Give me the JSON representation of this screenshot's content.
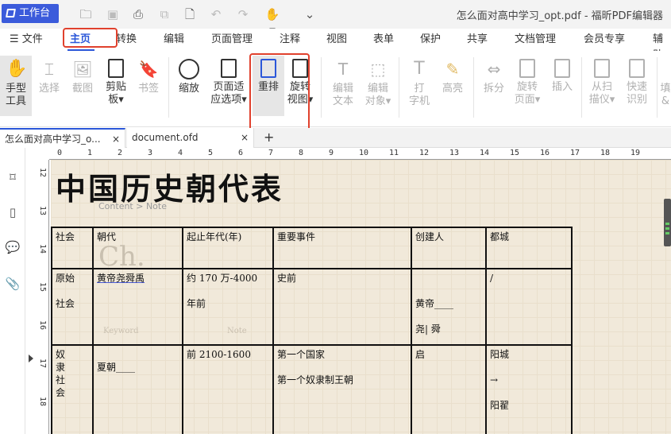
{
  "titlebar": {
    "workbench": "工作台",
    "window_title": "怎么面对高中学习_opt.pdf - 福昕PDF编辑器"
  },
  "menubar": {
    "file": "文件",
    "items": [
      "主页",
      "转换",
      "编辑",
      "页面管理",
      "注释",
      "视图",
      "表单",
      "保护",
      "共享",
      "文档管理",
      "会员专享",
      "辅助"
    ],
    "active": "主页"
  },
  "ribbon": {
    "hand": "手型\n工具",
    "select": "选择",
    "screenshot": "截图",
    "clipboard": "剪贴\n板▾",
    "bookmark": "书签",
    "zoom": "缩放",
    "fit_page": "页面适\n应选项▾",
    "reflow": "重排",
    "rotate_view": "旋转\n视图▾",
    "edit_text": "编辑\n文本",
    "edit_object": "编辑\n对象▾",
    "typewriter": "打\n字机",
    "highlight": "高亮",
    "split": "拆分",
    "rotate_page": "旋转\n页面▾",
    "insert": "插入",
    "from_scanner": "从扫\n描仪▾",
    "ocr": "快速\n识别",
    "more": "填\n&"
  },
  "tabs": [
    {
      "label": "怎么面对高中学习_o...",
      "close": "×"
    },
    {
      "label": "document.ofd",
      "close": "×"
    }
  ],
  "add_tab": "+",
  "ruler": {
    "h": [
      "0",
      "1",
      "2",
      "3",
      "4",
      "5",
      "6",
      "7",
      "8",
      "9",
      "10",
      "11",
      "12",
      "13",
      "14",
      "15",
      "16",
      "17",
      "18",
      "19"
    ],
    "v": [
      "12",
      "13",
      "14",
      "15",
      "16",
      "17",
      "18"
    ]
  },
  "document": {
    "title": "中国历史朝代表",
    "subtitle": "Content > Note",
    "ghost_ch": "Ch.",
    "ghost_keyword": "Keyword",
    "ghost_note": "Note",
    "headers": [
      "社会",
      "朝代",
      "起止年代(年)",
      "重要事件",
      "创建人",
      "都城"
    ],
    "row1": {
      "society": "原始\n\n社会",
      "dynasty": "黄帝尧舜禹",
      "period": "约 170 万-4000\n\n年前",
      "event": "史前",
      "founder": "\n\n黄帝____\n\n尧|    舜",
      "capital": "/"
    },
    "row2": {
      "society": "奴\n隶\n社\n会",
      "dynasty": "\n夏朝____",
      "period": "前 2100-1600",
      "event": "第一个国家\n\n第一个奴隶制王朝",
      "founder": "启",
      "capital": "阳城\n\n→\n\n阳翟"
    }
  }
}
